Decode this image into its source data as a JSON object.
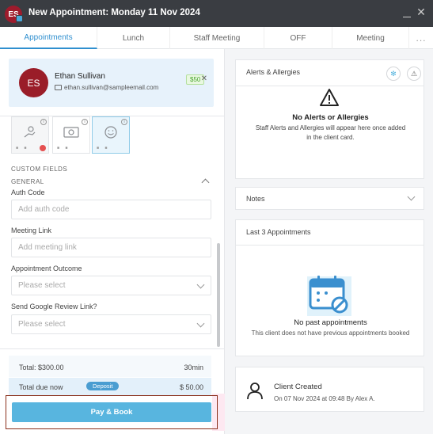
{
  "window": {
    "avatar_initials": "ES",
    "title": "New Appointment: Monday 11 Nov 2024",
    "minimize_icon": "minimize-icon",
    "close_glyph": "✕"
  },
  "tabs": [
    {
      "label": "Appointments",
      "active": true
    },
    {
      "label": "Lunch",
      "active": false
    },
    {
      "label": "Staff Meeting",
      "active": false
    },
    {
      "label": "OFF",
      "active": false
    },
    {
      "label": "Meeting",
      "active": false
    }
  ],
  "tabs_more": "...",
  "client": {
    "initials": "ES",
    "name": "Ethan Sullivan",
    "email": "ethan.sullivan@sampleemail.com",
    "balance": "$50",
    "close_glyph": "✕"
  },
  "custom_fields": {
    "heading": "CUSTOM FIELDS",
    "group": "GENERAL",
    "fields": [
      {
        "label": "Auth Code",
        "placeholder": "Add auth code",
        "type": "text"
      },
      {
        "label": "Meeting Link",
        "placeholder": "Add meeting link",
        "type": "text"
      },
      {
        "label": "Appointment Outcome",
        "placeholder": "Please select",
        "type": "select"
      },
      {
        "label": "Send Google Review Link?",
        "placeholder": "Please select",
        "type": "select"
      }
    ]
  },
  "summary": {
    "total_label": "Total: $300.00",
    "duration": "30min",
    "due_label": "Total due now",
    "deposit_badge": "Deposit",
    "due_amount": "$ 50.00"
  },
  "actions": {
    "pay_book_label": "Pay & Book"
  },
  "alerts": {
    "title": "Alerts & Allergies",
    "empty_title": "No Alerts or Allergies",
    "empty_line1": "Staff Alerts and Allergies will appear here once added",
    "empty_line2": "in the client card."
  },
  "notes": {
    "title": "Notes"
  },
  "last_appointments": {
    "title": "Last 3 Appointments",
    "empty_title": "No past appointments",
    "empty_sub": "This client does not have previous appointments booked"
  },
  "history": {
    "title": "Client Created",
    "detail": "On 07 Nov 2024 at 09:48 By Alex A."
  },
  "colors": {
    "accent": "#2f8fcf",
    "button": "#58b5df",
    "avatar": "#9a1d28",
    "titlebar": "#3a3d42"
  }
}
